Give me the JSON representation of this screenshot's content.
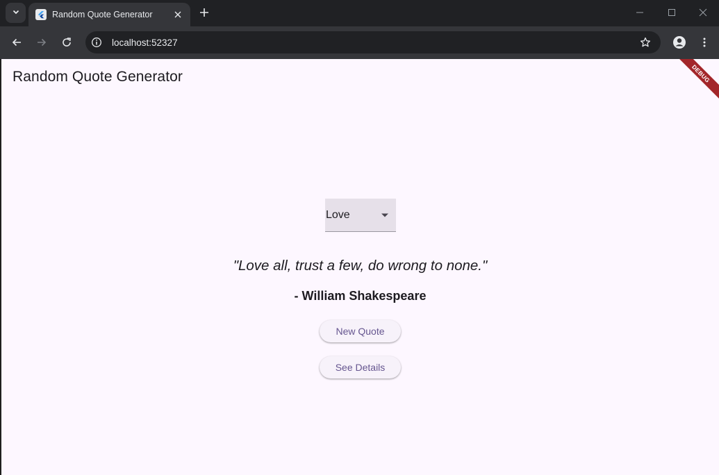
{
  "browser": {
    "tab": {
      "title": "Random Quote Generator",
      "favicon": "flutter-icon"
    },
    "address_bar": {
      "url": "localhost:52327"
    },
    "icons": {
      "tab_search": "chevron-down-icon",
      "new_tab": "plus-icon",
      "minimize": "minimize-icon",
      "maximize": "maximize-icon",
      "close": "close-icon",
      "back": "arrow-left-icon",
      "forward": "arrow-right-icon",
      "reload": "reload-icon",
      "site_info": "info-icon",
      "bookmark": "star-icon",
      "profile": "account-icon",
      "menu": "kebab-menu-icon"
    }
  },
  "app": {
    "title": "Random Quote Generator",
    "debug_banner": "DEBUG",
    "category_dropdown": {
      "selected": "Love"
    },
    "quote": {
      "text": "\"Love all, trust a few, do wrong to none.\"",
      "author": "- William Shakespeare"
    },
    "buttons": {
      "new_quote": "New Quote",
      "see_details": "See Details"
    }
  },
  "colors": {
    "browser_dark": "#202124",
    "toolbar": "#35363a",
    "app_background": "#fdf7ff",
    "primary_text": "#1d1b20",
    "button_text": "#65558f",
    "button_bg": "#f7f2fa",
    "dropdown_bg": "#e6e0e9",
    "debug_banner": "#a3262a"
  }
}
